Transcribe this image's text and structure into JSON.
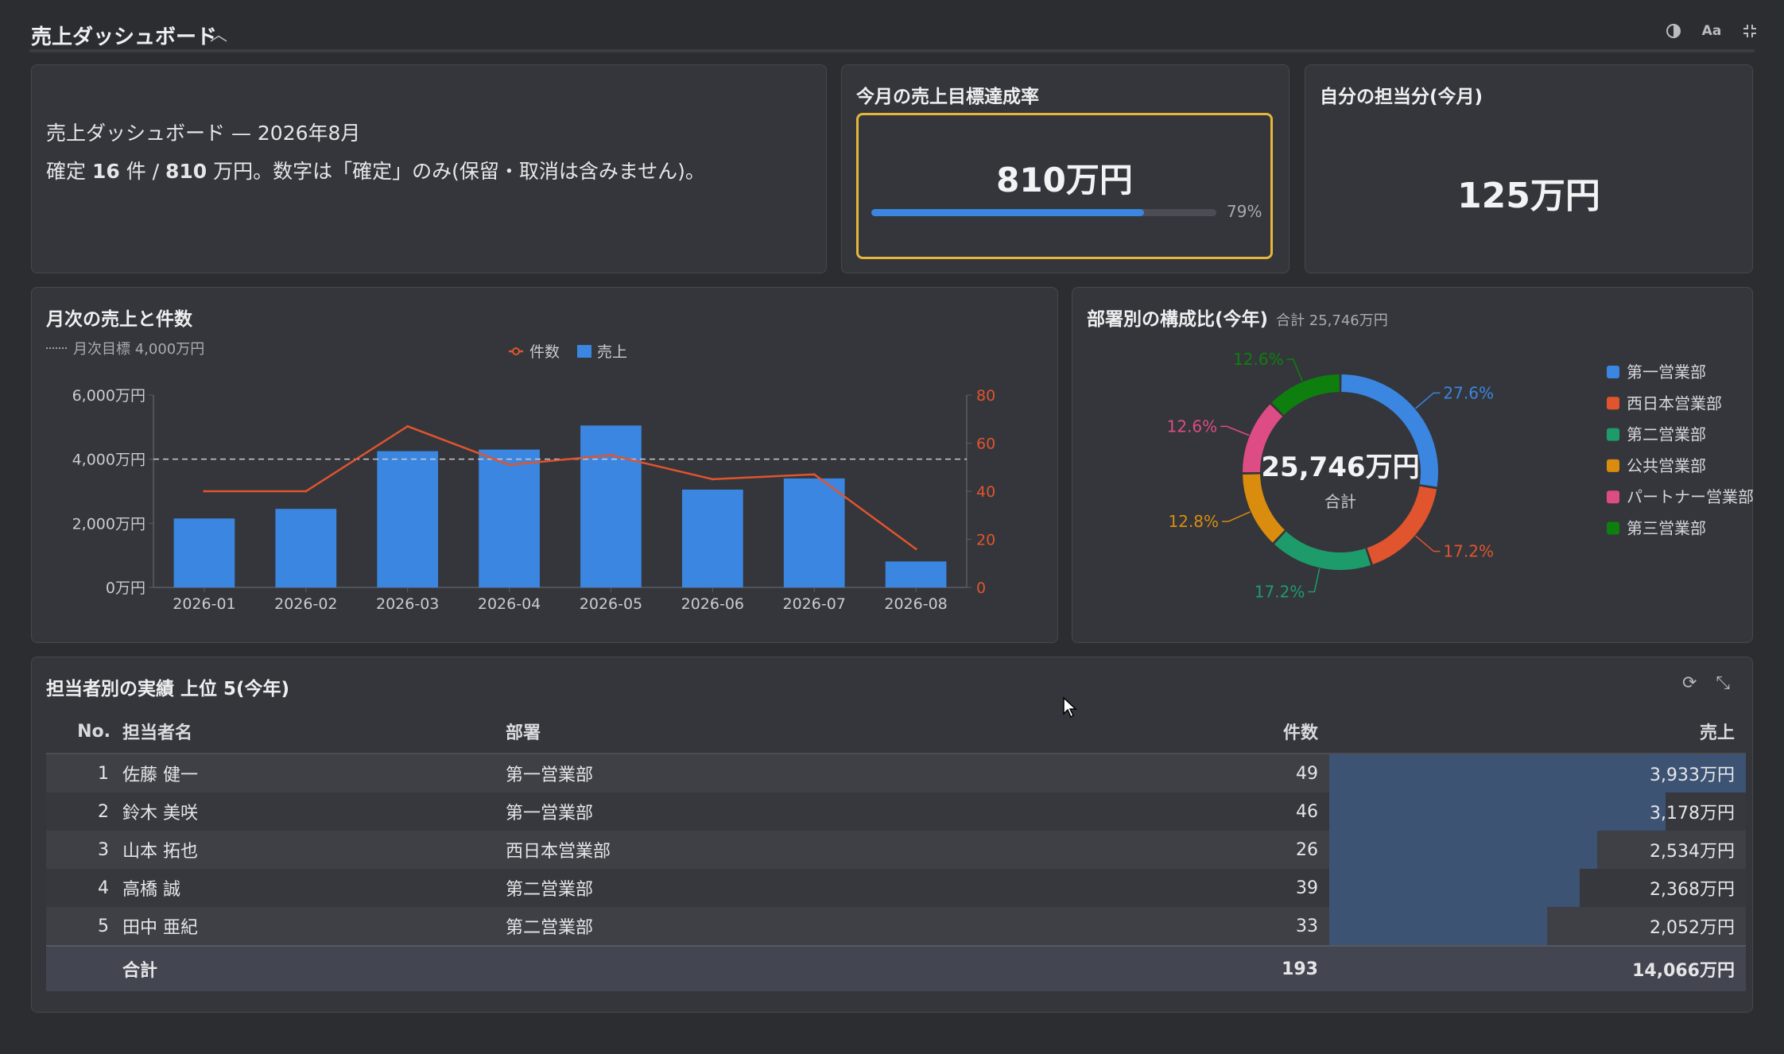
{
  "header": {
    "title": "売上ダッシュボード",
    "collapse_icon": "chevron-up-icon",
    "icons": [
      "contrast-icon",
      "font-size-icon",
      "collapse-screen-icon"
    ]
  },
  "info": {
    "line1": "売上ダッシュボード — 2026年8月",
    "line2_prefix": "確定 ",
    "count": "16",
    "line2_mid1": " 件 / ",
    "amount": "810",
    "line2_mid2": " 万円。数字は「確定」のみ(保留・取消は含みません)。"
  },
  "target": {
    "title": "今月の売上目標達成率",
    "value": "810万円",
    "progress": 0.79,
    "percent_label": "79%"
  },
  "mine": {
    "title": "自分の担当分(今月)",
    "value": "125万円"
  },
  "monthly": {
    "title": "月次の売上と件数",
    "target_note": "月次目標 4,000万円"
  },
  "chart_data": [
    {
      "type": "bar",
      "categories": [
        "2026-01",
        "2026-02",
        "2026-03",
        "2026-04",
        "2026-05",
        "2026-06",
        "2026-07",
        "2026-08"
      ],
      "series": [
        {
          "name": "売上",
          "kind": "bar",
          "axis": "left",
          "color": "#3b86e0",
          "values": [
            2150,
            2450,
            4250,
            4300,
            5050,
            3050,
            3400,
            810
          ]
        },
        {
          "name": "件数",
          "kind": "line",
          "axis": "right",
          "color": "#e0542e",
          "values": [
            40,
            40,
            67,
            51,
            55,
            45,
            47,
            16
          ]
        }
      ],
      "reference_line": {
        "value": 4000,
        "style": "dashed"
      },
      "y_left": {
        "range": [
          0,
          6000
        ],
        "ticks": [
          "0万円",
          "2,000万円",
          "4,000万円",
          "6,000万円"
        ]
      },
      "y_right": {
        "range": [
          0,
          80
        ],
        "ticks": [
          "0",
          "20",
          "40",
          "60",
          "80"
        ],
        "color": "#e0542e"
      },
      "legend": [
        "件数",
        "売上"
      ],
      "legend_position": "top-center",
      "grid": false
    },
    {
      "type": "pie",
      "title": "部署別の構成比(今年)",
      "subtitle": "合計 25,746万円",
      "center_value": "25,746万円",
      "center_label": "合計",
      "slices": [
        {
          "name": "第一営業部",
          "percent": 27.6,
          "label": "27.6%",
          "color": "#3b86e0"
        },
        {
          "name": "西日本営業部",
          "percent": 17.2,
          "label": "17.2%",
          "color": "#e0542e"
        },
        {
          "name": "第二営業部",
          "percent": 17.2,
          "label": "17.2%",
          "color": "#1e9b6b"
        },
        {
          "name": "公共営業部",
          "percent": 12.8,
          "label": "12.8%",
          "color": "#d98c0e"
        },
        {
          "name": "パートナー営業部",
          "percent": 12.6,
          "label": "12.6%",
          "color": "#dd4c85"
        },
        {
          "name": "第三営業部",
          "percent": 12.6,
          "label": "12.6%",
          "color": "#0e7f0e"
        }
      ],
      "legend_position": "right"
    }
  ],
  "table": {
    "title": "担当者別の実績 上位 5(今年)",
    "icons": [
      "refresh-icon",
      "expand-icon"
    ],
    "headers": {
      "no": "No.",
      "name": "担当者名",
      "dept": "部署",
      "count": "件数",
      "sales": "売上"
    },
    "rows": [
      {
        "no": "1",
        "name": "佐藤 健一",
        "dept": "第一営業部",
        "count": "49",
        "sales": "3,933万円",
        "ratio": 1.0
      },
      {
        "no": "2",
        "name": "鈴木 美咲",
        "dept": "第一営業部",
        "count": "46",
        "sales": "3,178万円",
        "ratio": 0.808
      },
      {
        "no": "3",
        "name": "山本 拓也",
        "dept": "西日本営業部",
        "count": "26",
        "sales": "2,534万円",
        "ratio": 0.644
      },
      {
        "no": "4",
        "name": "高橋 誠",
        "dept": "第二営業部",
        "count": "39",
        "sales": "2,368万円",
        "ratio": 0.602
      },
      {
        "no": "5",
        "name": "田中 亜紀",
        "dept": "第二営業部",
        "count": "33",
        "sales": "2,052万円",
        "ratio": 0.522
      }
    ],
    "total": {
      "label": "合計",
      "count": "193",
      "sales": "14,066万円"
    }
  }
}
